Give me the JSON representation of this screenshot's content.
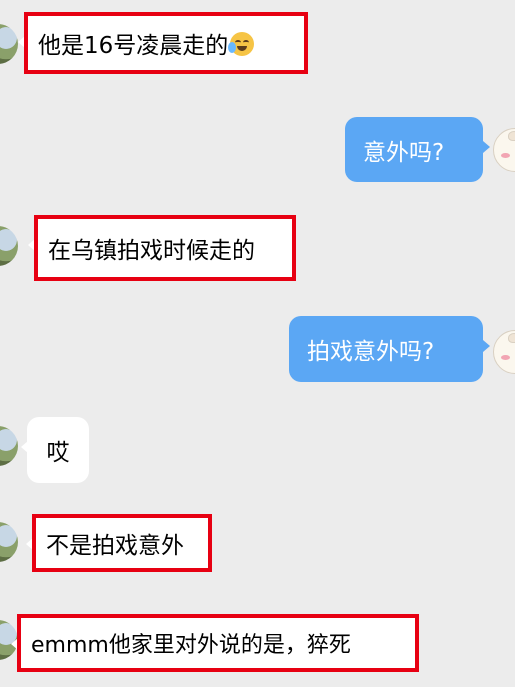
{
  "chat": {
    "messages": [
      {
        "sender": "other",
        "text": "他是16号凌晨走的",
        "emoji": "crying-laughing-face-icon",
        "highlighted": true
      },
      {
        "sender": "self",
        "text": "意外吗?"
      },
      {
        "sender": "other",
        "text": "在乌镇拍戏时候走的",
        "highlighted": true
      },
      {
        "sender": "self",
        "text": "拍戏意外吗?"
      },
      {
        "sender": "other",
        "text": "哎"
      },
      {
        "sender": "other",
        "text": "不是拍戏意外",
        "highlighted": true
      },
      {
        "sender": "other",
        "text": "emmm他家里对外说的是，猝死",
        "highlighted": true
      }
    ]
  },
  "colors": {
    "background": "#ececec",
    "incoming_bubble": "#ffffff",
    "outgoing_bubble": "#5ba7f4",
    "highlight": "#e70012"
  }
}
